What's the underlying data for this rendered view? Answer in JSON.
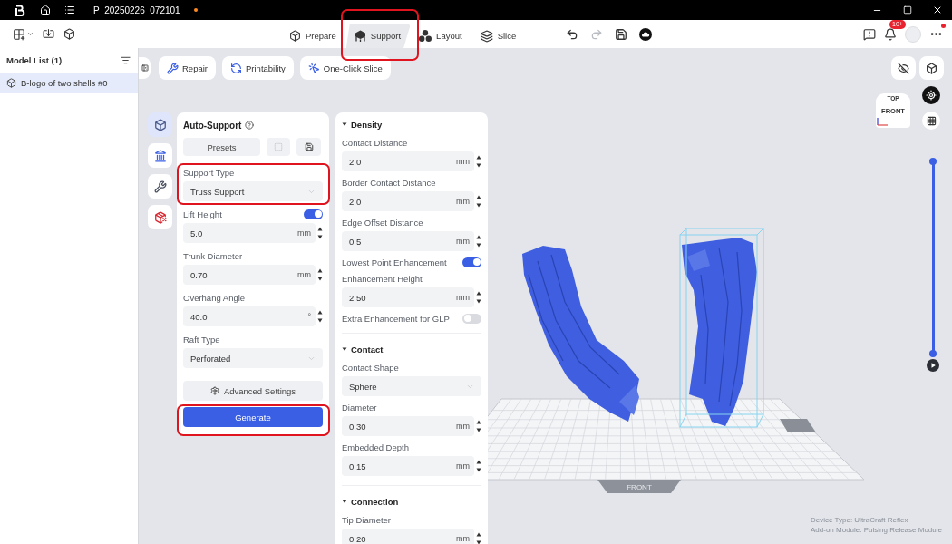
{
  "title_bar": {
    "title": "P_20250226_072101",
    "unsaved": true
  },
  "toolbar": {
    "tabs": [
      {
        "kind": "prepare",
        "label": "Prepare",
        "selected": false,
        "highlighted": false
      },
      {
        "kind": "support",
        "label": "Support",
        "selected": true,
        "highlighted": true
      },
      {
        "kind": "layout",
        "label": "Layout",
        "selected": false,
        "highlighted": false
      },
      {
        "kind": "slice",
        "label": "Slice",
        "selected": false,
        "highlighted": false
      }
    ],
    "redo_disabled": true,
    "notification_badge": "10+",
    "more_alert": true
  },
  "sidebar": {
    "title": "Model List (1)",
    "items": [
      {
        "label": "B-logo of two shells #0",
        "selected": true
      }
    ]
  },
  "actions": [
    {
      "kind": "repair",
      "label": "Repair"
    },
    {
      "kind": "printability",
      "label": "Printability"
    },
    {
      "kind": "slice",
      "label": "One-Click Slice"
    }
  ],
  "tool_rail": [
    {
      "kind": "auto",
      "selected": true
    },
    {
      "kind": "pillars",
      "selected": false
    },
    {
      "kind": "edit",
      "selected": false
    },
    {
      "kind": "delete",
      "selected": false
    }
  ],
  "support_panel": {
    "title": "Auto-Support",
    "presets": "Presets",
    "fields": [
      {
        "kind": "select",
        "label": "Support Type",
        "value": "Truss Support",
        "highlighted": true
      },
      {
        "kind": "number",
        "label": "Lift Height",
        "on": true,
        "value": "5.0",
        "unit": "mm",
        "highlighted": false
      },
      {
        "kind": "number",
        "label": "Trunk Diameter",
        "value": "0.70",
        "unit": "mm",
        "highlighted": false
      },
      {
        "kind": "number",
        "label": "Overhang Angle",
        "value": "40.0",
        "unit": "°",
        "highlighted": false
      },
      {
        "kind": "select",
        "label": "Raft Type",
        "value": "Perforated",
        "highlighted": false
      }
    ],
    "advanced": "Advanced Settings",
    "generate": {
      "label": "Generate",
      "highlighted": true
    }
  },
  "settings_panel": {
    "sections": [
      {
        "title": "Density",
        "expanded": true,
        "rows": [
          {
            "kind": "number",
            "label": "Contact Distance",
            "value": "2.0",
            "unit": "mm"
          },
          {
            "kind": "number",
            "label": "Border Contact Distance",
            "value": "2.0",
            "unit": "mm"
          },
          {
            "kind": "number",
            "label": "Edge Offset Distance",
            "value": "0.5",
            "unit": "mm"
          },
          {
            "kind": "toggle",
            "label": "Lowest Point Enhancement",
            "on": true
          },
          {
            "kind": "number",
            "label": "Enhancement Height",
            "value": "2.50",
            "unit": "mm"
          },
          {
            "kind": "toggle",
            "label": "Extra Enhancement for GLP",
            "on": false
          }
        ]
      },
      {
        "title": "Contact",
        "expanded": true,
        "rows": [
          {
            "kind": "select",
            "label": "Contact Shape",
            "value": "Sphere"
          },
          {
            "kind": "number",
            "label": "Diameter",
            "value": "0.30",
            "unit": "mm"
          },
          {
            "kind": "number",
            "label": "Embedded Depth",
            "value": "0.15",
            "unit": "mm"
          }
        ]
      },
      {
        "title": "Connection",
        "expanded": true,
        "rows": [
          {
            "kind": "number",
            "label": "Tip Diameter",
            "value": "0.20",
            "unit": "mm"
          }
        ]
      }
    ]
  },
  "viewport": {
    "view_cube": {
      "top": "TOP",
      "front": "FRONT"
    },
    "layer_slider": {
      "level": 1
    },
    "plate_label": "FRONT",
    "device_info": [
      "Device Type:  UltraCraft Reflex",
      "Add-on Module:  Pulsing Release Module"
    ]
  }
}
